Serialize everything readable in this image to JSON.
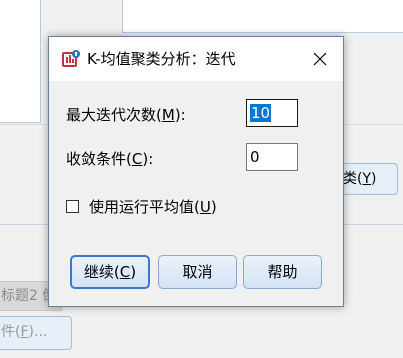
{
  "background": {
    "cluster_button_label": "类(",
    "cluster_button_key": "Y",
    "cluster_button_suffix": ")",
    "title_field_text": "标题2 倒",
    "file_button_label": "件(",
    "file_button_key": "F",
    "file_button_suffix": ")..."
  },
  "dialog": {
    "title": "K-均值聚类分析：迭代",
    "max_iterations": {
      "label": "最大迭代次数(",
      "key": "M",
      "suffix": "):",
      "value": "10"
    },
    "convergence": {
      "label": "收敛条件(",
      "key": "C",
      "suffix": "):",
      "value": "0"
    },
    "running_means": {
      "label": "使用运行平均值(",
      "key": "U",
      "suffix": ")",
      "checked": false
    },
    "buttons": {
      "continue_label": "继续(",
      "continue_key": "C",
      "continue_suffix": ")",
      "cancel_label": "取消",
      "help_label": "帮助"
    }
  },
  "colors": {
    "accent": "#0078d7",
    "default_button_border": "#3a79c9",
    "app_icon": "#c8303a"
  }
}
